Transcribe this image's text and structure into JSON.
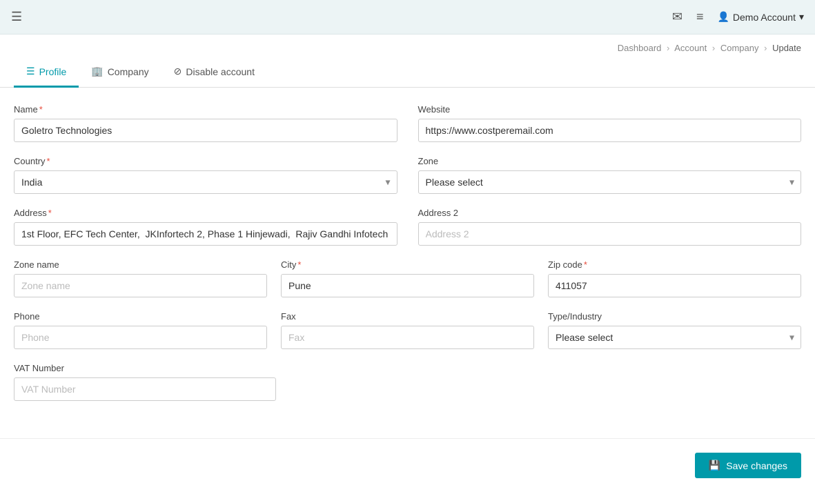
{
  "navbar": {
    "hamburger": "☰",
    "email_icon": "✉",
    "list_icon": "≡",
    "user_icon": "👤",
    "demo_account": "Demo Account",
    "chevron": "▾"
  },
  "breadcrumb": {
    "dashboard": "Dashboard",
    "account": "Account",
    "company": "Company",
    "update": "Update",
    "sep": "›"
  },
  "tabs": [
    {
      "id": "profile",
      "icon": "☰",
      "label": "Profile",
      "active": true
    },
    {
      "id": "company",
      "icon": "🏢",
      "label": "Company",
      "active": false
    },
    {
      "id": "disable",
      "icon": "⊘",
      "label": "Disable account",
      "active": false
    }
  ],
  "form": {
    "name_label": "Name",
    "name_required": "*",
    "name_value": "Goletro Technologies",
    "website_label": "Website",
    "website_value": "https://www.costperemail.com",
    "country_label": "Country",
    "country_required": "*",
    "country_value": "India",
    "zone_label": "Zone",
    "zone_placeholder": "Please select",
    "address_label": "Address",
    "address_required": "*",
    "address_value": "1st Floor, EFC Tech Center,  JKInfortech 2, Phase 1 Hinjewadi,  Rajiv Gandhi Infotech",
    "address2_label": "Address 2",
    "address2_placeholder": "Address 2",
    "zonename_label": "Zone name",
    "zonename_placeholder": "Zone name",
    "city_label": "City",
    "city_required": "*",
    "city_value": "Pune",
    "zipcode_label": "Zip code",
    "zipcode_required": "*",
    "zipcode_value": "411057",
    "phone_label": "Phone",
    "phone_placeholder": "Phone",
    "fax_label": "Fax",
    "fax_placeholder": "Fax",
    "type_label": "Type/Industry",
    "type_placeholder": "Please select",
    "vat_label": "VAT Number",
    "vat_placeholder": "VAT Number",
    "save_label": "Save changes",
    "save_icon": "💾"
  }
}
